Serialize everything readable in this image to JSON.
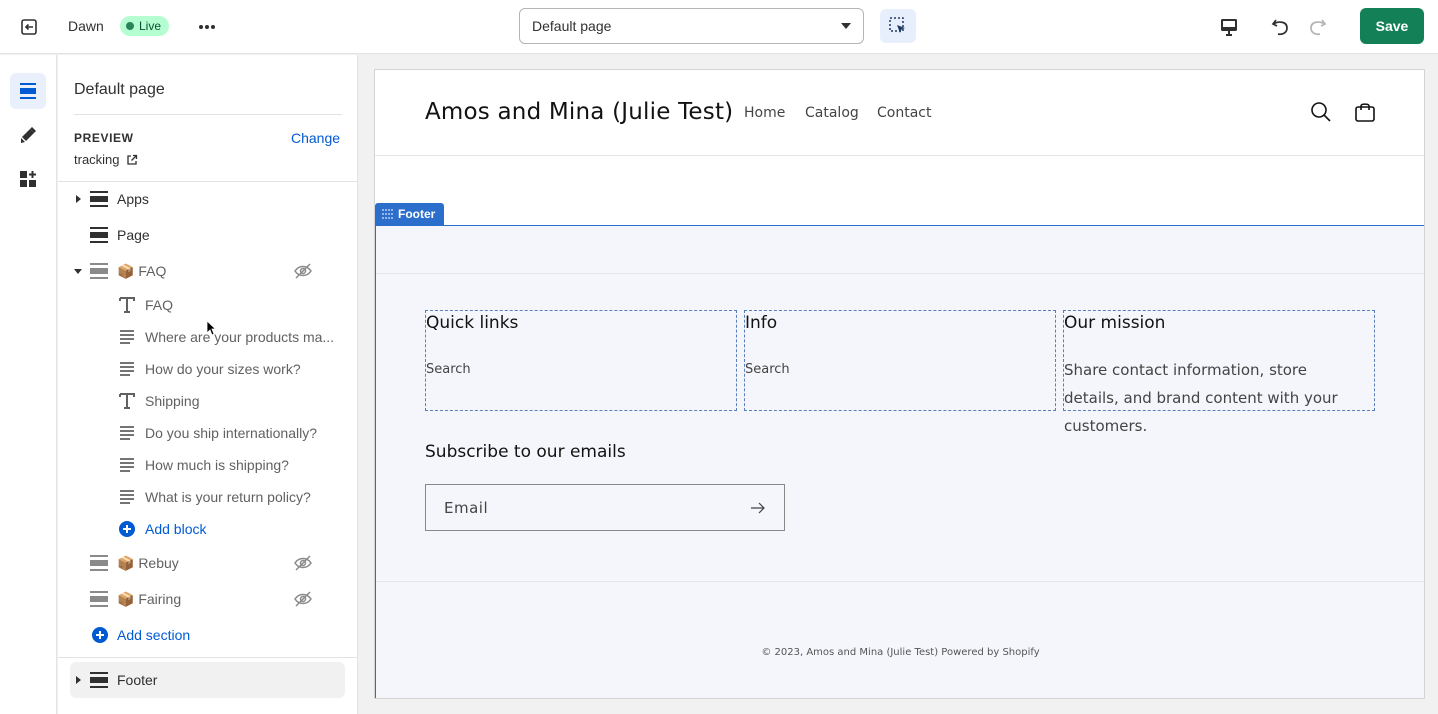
{
  "topbar": {
    "theme_name": "Dawn",
    "live_badge": "Live",
    "page_select_value": "Default page",
    "save_label": "Save",
    "accent_color": "#138057"
  },
  "sidebar": {
    "title": "Default page",
    "preview_label": "PREVIEW",
    "preview_change": "Change",
    "preview_value": "tracking",
    "sections": [
      {
        "label": "Apps",
        "hidden": false
      },
      {
        "label": "Page",
        "hidden": false
      },
      {
        "label": "📦 FAQ",
        "hidden": true
      },
      {
        "label": "📦 Rebuy",
        "hidden": true
      },
      {
        "label": "📦 Fairing",
        "hidden": true
      }
    ],
    "faq_blocks": [
      {
        "icon": "text-icon",
        "label": "FAQ"
      },
      {
        "icon": "paragraph-icon",
        "label": "Where are your products ma..."
      },
      {
        "icon": "paragraph-icon",
        "label": "How do your sizes work?"
      },
      {
        "icon": "text-icon",
        "label": "Shipping"
      },
      {
        "icon": "paragraph-icon",
        "label": "Do you ship internationally?"
      },
      {
        "icon": "paragraph-icon",
        "label": "How much is shipping?"
      },
      {
        "icon": "paragraph-icon",
        "label": "What is your return policy?"
      }
    ],
    "add_block": "Add block",
    "add_section": "Add section",
    "footer_label": "Footer"
  },
  "store": {
    "title": "Amos and Mina (Julie Test)",
    "nav": [
      "Home",
      "Catalog",
      "Contact"
    ],
    "footer_tag": "Footer",
    "blocks": [
      {
        "heading": "Quick links",
        "link": "Search"
      },
      {
        "heading": "Info",
        "link": "Search"
      },
      {
        "heading": "Our mission",
        "text": "Share contact information, store details, and brand content with your customers."
      }
    ],
    "subscribe_heading": "Subscribe to our emails",
    "email_placeholder": "Email",
    "copyright": "© 2023, Amos and Mina (Julie Test) Powered by Shopify"
  }
}
